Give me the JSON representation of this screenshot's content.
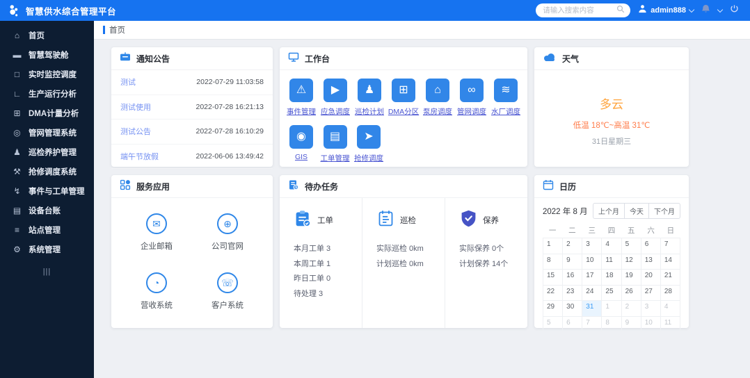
{
  "app": {
    "title": "智慧供水综合管理平台"
  },
  "header": {
    "search_placeholder": "请输入搜索内容",
    "username": "admin888"
  },
  "sidebar": {
    "items": [
      {
        "label": "首页",
        "icon": "home-icon",
        "glyph": "⌂",
        "active": true
      },
      {
        "label": "智慧驾驶舱",
        "icon": "cockpit-icon",
        "glyph": "▬"
      },
      {
        "label": "实时监控调度",
        "icon": "monitor-icon",
        "glyph": "□"
      },
      {
        "label": "生产运行分析",
        "icon": "analysis-chart-icon",
        "glyph": "∟"
      },
      {
        "label": "DMA计量分析",
        "icon": "dma-metering-icon",
        "glyph": "⊞"
      },
      {
        "label": "管网管理系统",
        "icon": "pipe-network-icon",
        "glyph": "◎"
      },
      {
        "label": "巡检养护管理",
        "icon": "patrol-maintenance-icon",
        "glyph": "♟"
      },
      {
        "label": "抢修调度系统",
        "icon": "repair-dispatch-icon",
        "glyph": "⚒"
      },
      {
        "label": "事件与工单管理",
        "icon": "event-workorder-icon",
        "glyph": "↯"
      },
      {
        "label": "设备台账",
        "icon": "equipment-ledger-icon",
        "glyph": "▤"
      },
      {
        "label": "站点管理",
        "icon": "station-management-icon",
        "glyph": "≡"
      },
      {
        "label": "系统管理",
        "icon": "system-settings-icon",
        "glyph": "⚙"
      }
    ],
    "collapse_label": "|||"
  },
  "tab": {
    "label": "首页"
  },
  "notice": {
    "title": "通知公告",
    "items": [
      {
        "title": "测试",
        "time": "2022-07-29 11:03:58"
      },
      {
        "title": "测试使用",
        "time": "2022-07-28 16:21:13"
      },
      {
        "title": "测试公告",
        "time": "2022-07-28 16:10:29"
      },
      {
        "title": "端午节放假",
        "time": "2022-06-06 13:49:42"
      }
    ]
  },
  "workbench": {
    "title": "工作台",
    "row1": [
      {
        "label": "事件管理",
        "icon": "event-management-icon",
        "glyph": "⚠"
      },
      {
        "label": "应急调度",
        "icon": "emergency-dispatch-icon",
        "glyph": "▶"
      },
      {
        "label": "巡检计划",
        "icon": "patrol-plan-icon",
        "glyph": "♟"
      },
      {
        "label": "DMA分区",
        "icon": "dma-partition-icon",
        "glyph": "⊞"
      },
      {
        "label": "泵房调度",
        "icon": "pump-house-icon",
        "glyph": "⌂"
      },
      {
        "label": "管网调度",
        "icon": "pipe-dispatch-icon",
        "glyph": "∞"
      },
      {
        "label": "水厂调度",
        "icon": "water-plant-icon",
        "glyph": "≋"
      }
    ],
    "row2": [
      {
        "label": "GIS",
        "icon": "gis-icon",
        "glyph": "◉"
      },
      {
        "label": "工单管理",
        "icon": "work-order-icon",
        "glyph": "▤"
      },
      {
        "label": "抢修调度",
        "icon": "repair-route-icon",
        "glyph": "➤"
      }
    ]
  },
  "weather": {
    "title": "天气",
    "condition": "多云",
    "temp_range": "低温 18℃~高温 31℃",
    "date": "31日星期三"
  },
  "services": {
    "title": "服务应用",
    "items": [
      {
        "label": "企业邮箱",
        "icon": "email-icon",
        "glyph": "✉"
      },
      {
        "label": "公司官网",
        "icon": "website-icon",
        "glyph": "⊕"
      },
      {
        "label": "营收系统",
        "icon": "revenue-icon",
        "glyph": "◔"
      },
      {
        "label": "客户系统",
        "icon": "customer-icon",
        "glyph": "☏"
      }
    ]
  },
  "todo": {
    "title": "待办任务",
    "workorder": {
      "label": "工单",
      "lines": [
        "本月工单 3",
        "本周工单 1",
        "昨日工单 0",
        "待处理 3"
      ]
    },
    "inspection": {
      "label": "巡检",
      "lines": [
        "实际巡检 0km",
        "计划巡检 0km"
      ]
    },
    "maintenance": {
      "label": "保养",
      "lines": [
        "实际保养 0个",
        "计划保养 14个"
      ]
    }
  },
  "calendar": {
    "title": "日历",
    "month_label": "2022 年 8 月",
    "prev_label": "上个月",
    "today_label": "今天",
    "next_label": "下个月",
    "weekdays": [
      "一",
      "二",
      "三",
      "四",
      "五",
      "六",
      "日"
    ],
    "cells": [
      {
        "n": "1"
      },
      {
        "n": "2"
      },
      {
        "n": "3"
      },
      {
        "n": "4"
      },
      {
        "n": "5"
      },
      {
        "n": "6"
      },
      {
        "n": "7"
      },
      {
        "n": "8"
      },
      {
        "n": "9"
      },
      {
        "n": "10"
      },
      {
        "n": "11"
      },
      {
        "n": "12"
      },
      {
        "n": "13"
      },
      {
        "n": "14"
      },
      {
        "n": "15"
      },
      {
        "n": "16"
      },
      {
        "n": "17"
      },
      {
        "n": "18"
      },
      {
        "n": "19"
      },
      {
        "n": "20"
      },
      {
        "n": "21"
      },
      {
        "n": "22"
      },
      {
        "n": "23"
      },
      {
        "n": "24"
      },
      {
        "n": "25"
      },
      {
        "n": "26"
      },
      {
        "n": "27"
      },
      {
        "n": "28"
      },
      {
        "n": "29"
      },
      {
        "n": "30"
      },
      {
        "n": "31",
        "today": true
      },
      {
        "n": "1",
        "muted": true
      },
      {
        "n": "2",
        "muted": true
      },
      {
        "n": "3",
        "muted": true
      },
      {
        "n": "4",
        "muted": true
      },
      {
        "n": "5",
        "muted": true
      },
      {
        "n": "6",
        "muted": true
      },
      {
        "n": "7",
        "muted": true
      },
      {
        "n": "8",
        "muted": true
      },
      {
        "n": "9",
        "muted": true
      },
      {
        "n": "10",
        "muted": true
      },
      {
        "n": "11",
        "muted": true
      }
    ]
  },
  "colors": {
    "header_blue": "#1673f0",
    "sidebar_navy": "#0d1d32",
    "tile_blue": "#3186e8",
    "link_blue": "#4a55d2",
    "weather_orange": "#ffa43d",
    "maintenance_indigo": "#4653c5",
    "today_highlight": "#e9f4fe"
  }
}
